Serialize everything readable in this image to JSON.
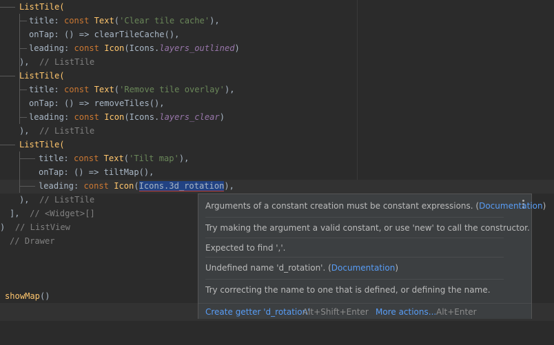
{
  "code": {
    "l1": "ListTile(",
    "l2_a": "title: ",
    "l2_kw": "const ",
    "l2_cls": "Text",
    "l2_p1": "(",
    "l2_str": "'Clear tile cache'",
    "l2_p2": "),",
    "l3": "onTap: () => clearTileCache(),",
    "l4_a": "leading: ",
    "l4_kw": "const ",
    "l4_cls": "Icon",
    "l4_b": "(Icons.",
    "l4_it": "layers_outlined",
    "l4_c": ")",
    "l5_a": "),",
    "l5_cm": "// ListTile",
    "l6": "ListTile(",
    "l7_a": "title: ",
    "l7_kw": "const ",
    "l7_cls": "Text",
    "l7_p1": "(",
    "l7_str": "'Remove tile overlay'",
    "l7_p2": "),",
    "l8": "onTap: () => removeTiles(),",
    "l9_a": "leading: ",
    "l9_kw": "const ",
    "l9_cls": "Icon",
    "l9_b": "(Icons.",
    "l9_it": "layers_clear",
    "l9_c": ")",
    "l10_a": "),",
    "l10_cm": "// ListTile",
    "l11": "ListTile(",
    "l12_a": "title: ",
    "l12_kw": "const ",
    "l12_cls": "Text",
    "l12_p1": "(",
    "l12_str": "'Tilt map'",
    "l12_p2": "),",
    "l13": "onTap: () => tiltMap(),",
    "l14_a": "leading: ",
    "l14_kw": "const ",
    "l14_cls": "Icon",
    "l14_p1": "(",
    "l14_err": "Icons.3d_rotation",
    "l14_p2": "),",
    "l15_a": "),",
    "l15_cm": "// ListTile",
    "l16_a": "],",
    "l16_cm": "// <Widget>[]",
    "l17_a": ")",
    "l17_cm": "// ListView",
    "l18_cm": "// Drawer",
    "l19_fn": "showMap",
    "l19_b": "()"
  },
  "popup": {
    "msg1": "Arguments of a constant creation must be constant expressions. (",
    "msg1_link": "Documentation",
    "msg1_end": ")",
    "msg2": "Try making the argument a valid constant, or use 'new' to call the constructor.",
    "msg3": "Expected to find ','.",
    "msg4": "Undefined name 'd_rotation'. (",
    "msg4_link": "Documentation",
    "msg4_end": ")",
    "msg5": "Try correcting the name to one that is defined, or defining the name.",
    "action1": "Create getter 'd_rotation'",
    "action1_shortcut": "Alt+Shift+Enter",
    "action2": "More actions...",
    "action2_shortcut": "Alt+Enter"
  }
}
